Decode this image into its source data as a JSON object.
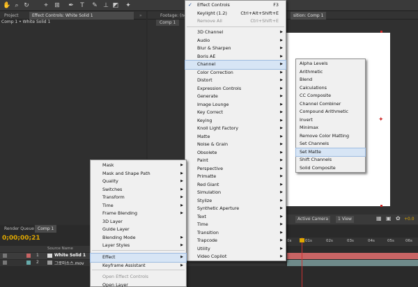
{
  "panels": {
    "project_tab": "Project",
    "effect_controls_tab": "Effect Controls: White Solid 1",
    "footage_tab": "Footage: (no",
    "composition_tab": "sition: Comp 1",
    "effect_controls_breadcrumb": "Comp 1 • White Solid 1",
    "footage_subtab": "Comp 1"
  },
  "viewer": {
    "camera": "Active Camera",
    "views": "1 View",
    "exposure": "+0.0"
  },
  "timeline": {
    "render_queue_tab": "Render Queue",
    "comp_tab": "Comp 1",
    "timecode": "0;00;00;21",
    "column_source_name": "Source Name",
    "ruler_ticks": [
      "0s",
      "01s",
      "02s",
      "03s",
      "04s",
      "05s",
      "06s"
    ],
    "layers": [
      {
        "number": "1",
        "name": "White Solid 1"
      },
      {
        "number": "2",
        "name": "그로마소스.mov"
      }
    ]
  },
  "menu_main": {
    "items": [
      {
        "label": "Effect Controls",
        "shortcut": "F3",
        "checked": true
      },
      {
        "label": "Keylight (1.2)",
        "shortcut": "Ctrl+Alt+Shift+E"
      },
      {
        "label": "Remove All",
        "shortcut": "Ctrl+Shift+E",
        "disabled": true
      },
      {
        "label": "3D Channel"
      },
      {
        "label": "Audio"
      },
      {
        "label": "Blur & Sharpen"
      },
      {
        "label": "Boris AE"
      },
      {
        "label": "Channel"
      },
      {
        "label": "Color Correction"
      },
      {
        "label": "Distort"
      },
      {
        "label": "Expression Controls"
      },
      {
        "label": "Generate"
      },
      {
        "label": "Image Lounge"
      },
      {
        "label": "Key Correct"
      },
      {
        "label": "Keying"
      },
      {
        "label": "Knoll Light Factory"
      },
      {
        "label": "Matte"
      },
      {
        "label": "Noise & Grain"
      },
      {
        "label": "Obsolete"
      },
      {
        "label": "Paint"
      },
      {
        "label": "Perspective"
      },
      {
        "label": "Primatte"
      },
      {
        "label": "Red Giant"
      },
      {
        "label": "Simulation"
      },
      {
        "label": "Stylize"
      },
      {
        "label": "Synthetic Aperture"
      },
      {
        "label": "Text"
      },
      {
        "label": "Time"
      },
      {
        "label": "Transition"
      },
      {
        "label": "Trapcode"
      },
      {
        "label": "Utility"
      },
      {
        "label": "Video Copilot"
      }
    ]
  },
  "menu_channel": {
    "items": [
      "Alpha Levels",
      "Arithmetic",
      "Blend",
      "Calculations",
      "CC Composite",
      "Channel Combiner",
      "Compound Arithmetic",
      "Invert",
      "Minimax",
      "Remove Color Matting",
      "Set Channels",
      "Set Matte",
      "Shift Channels",
      "Solid Composite"
    ]
  },
  "menu_layer": {
    "items": [
      {
        "label": "Mask"
      },
      {
        "label": "Mask and Shape Path"
      },
      {
        "label": "Quality"
      },
      {
        "label": "Switches"
      },
      {
        "label": "Transform"
      },
      {
        "label": "Time"
      },
      {
        "label": "Frame Blending"
      },
      {
        "label": "3D Layer",
        "noarrow": true
      },
      {
        "label": "Guide Layer",
        "noarrow": true
      },
      {
        "label": "Blending Mode"
      },
      {
        "label": "Layer Styles"
      },
      {
        "label": "Effect"
      },
      {
        "label": "Keyframe Assistant"
      },
      {
        "label": "Open Effect Controls",
        "disabled": true,
        "noarrow": true
      },
      {
        "label": "Open Layer",
        "noarrow": true
      }
    ]
  },
  "colors": {
    "highlight": "#d7e5f5",
    "timecode": "#e0a800",
    "layer_bar": "#c86464",
    "playhead": "#cc3333"
  },
  "icons": [
    "hand-icon",
    "zoom-icon",
    "rotate-icon",
    "camera-icon",
    "pen-icon",
    "text-icon",
    "brush-icon",
    "stamp-icon",
    "eraser-icon"
  ]
}
